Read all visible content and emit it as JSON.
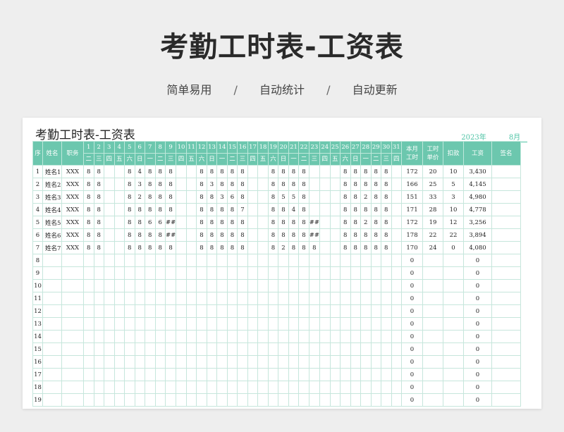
{
  "hero": {
    "title": "考勤工时表-工资表",
    "tags": [
      "简单易用",
      "自动统计",
      "自动更新"
    ],
    "sep": "/"
  },
  "sheet": {
    "title": "考勤工时表-工资表",
    "year": "2023年",
    "month": "8月",
    "headers": {
      "seq": "序",
      "name": "姓名",
      "job": "职务",
      "hours1": "本月",
      "hours2": "工时",
      "rate1": "工时",
      "rate2": "单价",
      "deduct": "扣款",
      "wage": "工资",
      "sign": "签名"
    },
    "days": [
      "1",
      "2",
      "3",
      "4",
      "5",
      "6",
      "7",
      "8",
      "9",
      "10",
      "11",
      "12",
      "13",
      "14",
      "15",
      "16",
      "17",
      "18",
      "19",
      "20",
      "21",
      "22",
      "23",
      "24",
      "25",
      "26",
      "27",
      "28",
      "29",
      "30",
      "31"
    ],
    "weekdays": [
      "二",
      "三",
      "四",
      "五",
      "六",
      "日",
      "一",
      "二",
      "三",
      "四",
      "五",
      "六",
      "日",
      "一",
      "二",
      "三",
      "四",
      "五",
      "六",
      "日",
      "一",
      "二",
      "三",
      "四",
      "五",
      "六",
      "日",
      "一",
      "二",
      "三",
      "四"
    ],
    "rows": [
      {
        "seq": "1",
        "name": "姓名1",
        "job": "XXX",
        "days": [
          "8",
          "8",
          "",
          "",
          "8",
          "4",
          "8",
          "8",
          "8",
          "",
          "",
          "8",
          "8",
          "8",
          "8",
          "8",
          "",
          "",
          "8",
          "8",
          "8",
          "8",
          "",
          "",
          "",
          "8",
          "8",
          "8",
          "8",
          "8",
          ""
        ],
        "hours": "172",
        "rate": "20",
        "deduct": "10",
        "wage": "3,430"
      },
      {
        "seq": "2",
        "name": "姓名2",
        "job": "XXX",
        "days": [
          "8",
          "8",
          "",
          "",
          "8",
          "3",
          "8",
          "8",
          "8",
          "",
          "",
          "8",
          "3",
          "8",
          "8",
          "8",
          "",
          "",
          "8",
          "8",
          "8",
          "8",
          "",
          "",
          "",
          "8",
          "8",
          "8",
          "8",
          "8",
          ""
        ],
        "hours": "166",
        "rate": "25",
        "deduct": "5",
        "wage": "4,145"
      },
      {
        "seq": "3",
        "name": "姓名3",
        "job": "XXX",
        "days": [
          "8",
          "8",
          "",
          "",
          "8",
          "2",
          "8",
          "8",
          "8",
          "",
          "",
          "8",
          "8",
          "3",
          "6",
          "8",
          "",
          "",
          "8",
          "5",
          "5",
          "8",
          "",
          "",
          "",
          "8",
          "8",
          "2",
          "8",
          "8",
          ""
        ],
        "hours": "151",
        "rate": "33",
        "deduct": "3",
        "wage": "4,980"
      },
      {
        "seq": "4",
        "name": "姓名4",
        "job": "XXX",
        "days": [
          "8",
          "8",
          "",
          "",
          "8",
          "8",
          "8",
          "8",
          "8",
          "",
          "",
          "8",
          "8",
          "8",
          "8",
          "7",
          "",
          "",
          "8",
          "8",
          "4",
          "8",
          "",
          "",
          "",
          "8",
          "8",
          "8",
          "8",
          "8",
          ""
        ],
        "hours": "171",
        "rate": "28",
        "deduct": "10",
        "wage": "4,778"
      },
      {
        "seq": "5",
        "name": "姓名5",
        "job": "XXX",
        "days": [
          "8",
          "8",
          "",
          "",
          "8",
          "8",
          "6",
          "6",
          "##",
          "",
          "",
          "8",
          "8",
          "8",
          "8",
          "8",
          "",
          "",
          "8",
          "8",
          "8",
          "8",
          "##",
          "",
          "",
          "8",
          "8",
          "2",
          "8",
          "8",
          ""
        ],
        "hours": "172",
        "rate": "19",
        "deduct": "12",
        "wage": "3,256"
      },
      {
        "seq": "6",
        "name": "姓名6",
        "job": "XXX",
        "days": [
          "8",
          "8",
          "",
          "",
          "8",
          "8",
          "8",
          "8",
          "##",
          "",
          "",
          "8",
          "8",
          "8",
          "8",
          "8",
          "",
          "",
          "8",
          "8",
          "8",
          "8",
          "##",
          "",
          "",
          "8",
          "8",
          "8",
          "8",
          "8",
          ""
        ],
        "hours": "178",
        "rate": "22",
        "deduct": "22",
        "wage": "3,894"
      },
      {
        "seq": "7",
        "name": "姓名7",
        "job": "XXX",
        "days": [
          "8",
          "8",
          "",
          "",
          "8",
          "8",
          "8",
          "8",
          "8",
          "",
          "",
          "8",
          "8",
          "8",
          "8",
          "8",
          "",
          "",
          "8",
          "2",
          "8",
          "8",
          "8",
          "",
          "",
          "8",
          "8",
          "8",
          "8",
          "8",
          ""
        ],
        "hours": "170",
        "rate": "24",
        "deduct": "0",
        "wage": "4,080"
      },
      {
        "seq": "8",
        "hours": "0",
        "wage": "0"
      },
      {
        "seq": "9",
        "hours": "0",
        "wage": "0"
      },
      {
        "seq": "10",
        "hours": "0",
        "wage": "0"
      },
      {
        "seq": "11",
        "hours": "0",
        "wage": "0"
      },
      {
        "seq": "12",
        "hours": "0",
        "wage": "0"
      },
      {
        "seq": "13",
        "hours": "0",
        "wage": "0"
      },
      {
        "seq": "14",
        "hours": "0",
        "wage": "0"
      },
      {
        "seq": "15",
        "hours": "0",
        "wage": "0"
      },
      {
        "seq": "16",
        "hours": "0",
        "wage": "0"
      },
      {
        "seq": "17",
        "hours": "0",
        "wage": "0"
      },
      {
        "seq": "18",
        "hours": "0",
        "wage": "0"
      },
      {
        "seq": "19",
        "hours": "0",
        "wage": "0"
      }
    ]
  }
}
